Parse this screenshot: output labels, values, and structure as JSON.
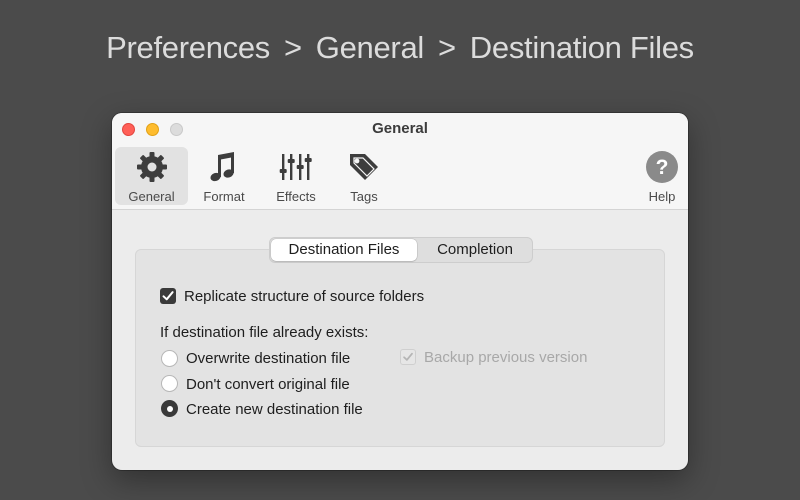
{
  "breadcrumb": {
    "items": [
      "Preferences",
      "General",
      "Destination Files"
    ],
    "separator": ">"
  },
  "window": {
    "title": "General",
    "toolbar": {
      "items": [
        {
          "label": "General",
          "icon": "gear-icon",
          "selected": true
        },
        {
          "label": "Format",
          "icon": "music-note-icon",
          "selected": false
        },
        {
          "label": "Effects",
          "icon": "sliders-icon",
          "selected": false
        },
        {
          "label": "Tags",
          "icon": "tag-icon",
          "selected": false
        },
        {
          "label": "Help",
          "icon": "help-icon",
          "selected": false
        }
      ]
    },
    "tabs": {
      "items": [
        "Destination Files",
        "Completion"
      ],
      "active": "Destination Files"
    },
    "replicate": {
      "label": "Replicate structure of source folders",
      "checked": true
    },
    "exists_label": "If destination file already exists:",
    "options": [
      {
        "label": "Overwrite destination file",
        "selected": false
      },
      {
        "label": "Don't convert original file",
        "selected": false
      },
      {
        "label": "Create new destination file",
        "selected": true
      }
    ],
    "backup": {
      "label": "Backup previous version",
      "checked": true,
      "enabled": false
    }
  },
  "colors": {
    "background": "#4b4b4b",
    "window": "#ececec",
    "close": "#ff5f57",
    "minimize": "#febc2e",
    "accent": "#3a3a3a"
  }
}
